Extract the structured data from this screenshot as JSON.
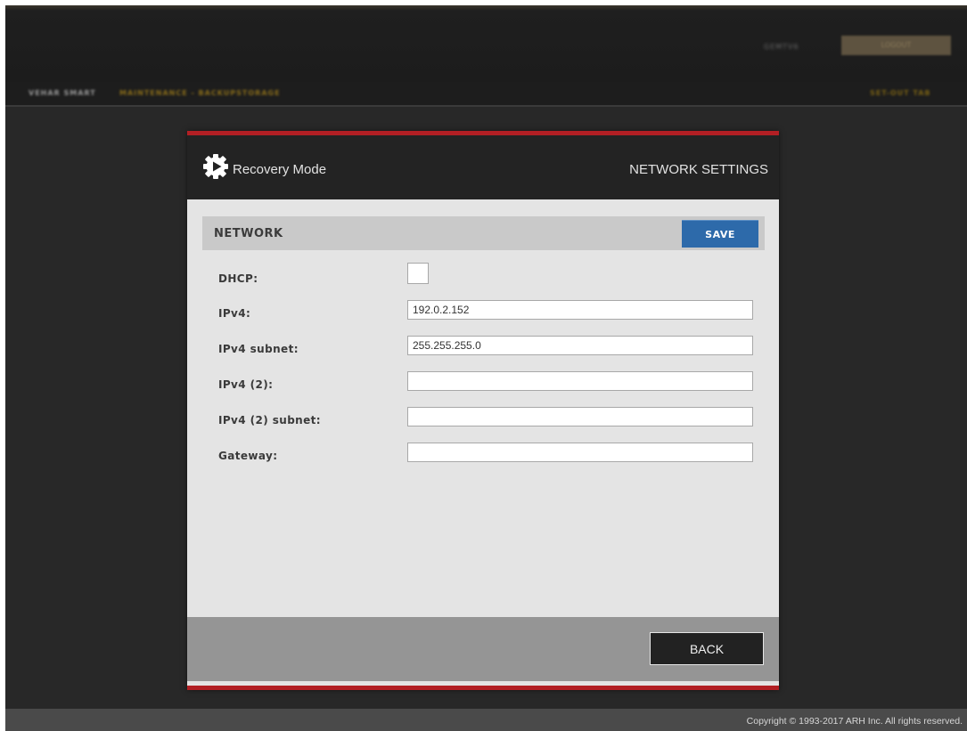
{
  "header": {
    "user_label": "GEMTV6",
    "user_button_label": "LOGOUT"
  },
  "breadcrumb": {
    "home": "VEHAR SMART",
    "section": "MAINTENANCE - BACKUPSTORAGE",
    "right_label": "SET-OUT TAB"
  },
  "dialog": {
    "title": "Recovery Mode",
    "page_title": "NETWORK SETTINGS",
    "section_title": "NETWORK",
    "save_label": "SAVE",
    "back_label": "BACK"
  },
  "form": {
    "dhcp_label": "DHCP:",
    "dhcp_checked": false,
    "ipv4_label": "IPv4:",
    "ipv4_value": "192.0.2.152",
    "ipv4_subnet_label": "IPv4 subnet:",
    "ipv4_subnet_value": "255.255.255.0",
    "ipv4_2_label": "IPv4 (2):",
    "ipv4_2_value": "",
    "ipv4_2_subnet_label": "IPv4 (2) subnet:",
    "ipv4_2_subnet_value": "",
    "gateway_label": "Gateway:",
    "gateway_value": ""
  },
  "footer": {
    "copyright": "Copyright © 1993-2017 ARH Inc. All rights reserved."
  },
  "colors": {
    "accent_red": "#b21f24",
    "save_blue": "#2d6aaa",
    "dialog_header": "#232323",
    "dialog_body": "#e4e4e4"
  },
  "icons": {
    "logo": "gear-play-icon"
  }
}
